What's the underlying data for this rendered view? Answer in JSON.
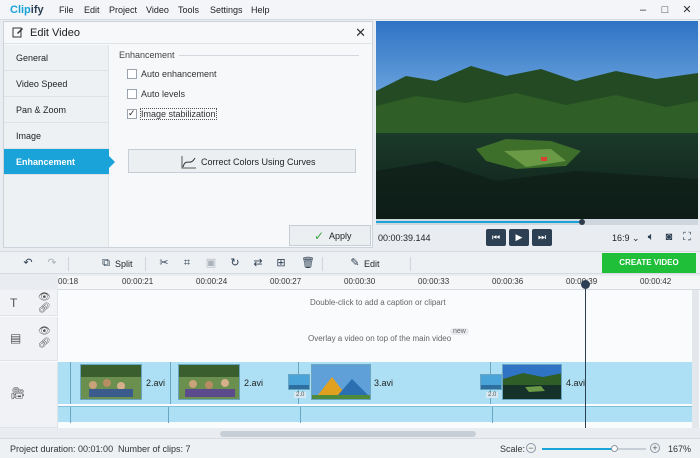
{
  "app": {
    "logo_text_a": "Clip",
    "logo_text_b": "ify"
  },
  "menu": [
    "File",
    "Edit",
    "Project",
    "Video",
    "Tools",
    "Settings",
    "Help"
  ],
  "edit_panel": {
    "title": "Edit Video",
    "tabs": [
      "General",
      "Video Speed",
      "Pan & Zoom",
      "Image",
      "Enhancement"
    ],
    "active_tab": "Enhancement",
    "section_label": "Enhancement",
    "options": [
      {
        "label": "Auto enhancement",
        "checked": false
      },
      {
        "label": "Auto levels",
        "checked": false
      },
      {
        "label": "Image stabilization",
        "checked": true
      }
    ],
    "curves_button": "Correct Colors Using Curves",
    "apply_button": "Apply"
  },
  "player": {
    "timecode": "00:00:39.144",
    "aspect_ratio": "16:9",
    "progress": 0.64
  },
  "toolbar": {
    "split_label": "Split",
    "edit_label": "Edit",
    "create_video_label": "CREATE VIDEO"
  },
  "ruler": {
    "ticks": [
      "00:18",
      "00:00:21",
      "00:00:24",
      "00:00:27",
      "00:00:30",
      "00:00:33",
      "00:00:36",
      "00:00:39",
      "00:00:42"
    ]
  },
  "timeline": {
    "caption_hint": "Double-click to add a caption or clipart",
    "overlay_hint": "Overlay a video on top of the main video",
    "new_badge": "new",
    "clips": [
      {
        "name": "2.avi"
      },
      {
        "name": "2.avi"
      },
      {
        "name": "3.avi"
      },
      {
        "name": "4.avi"
      }
    ],
    "transition_duration": "2.0"
  },
  "status": {
    "project_duration": "Project duration: 00:01:00",
    "clip_count": "Number of clips: 7",
    "scale_label": "Scale:",
    "scale_value": "167%",
    "scale_level": 0.7
  },
  "colors": {
    "accent": "#1aa3d9",
    "create_button": "#1fbf3a",
    "track": "#ade0f5"
  }
}
